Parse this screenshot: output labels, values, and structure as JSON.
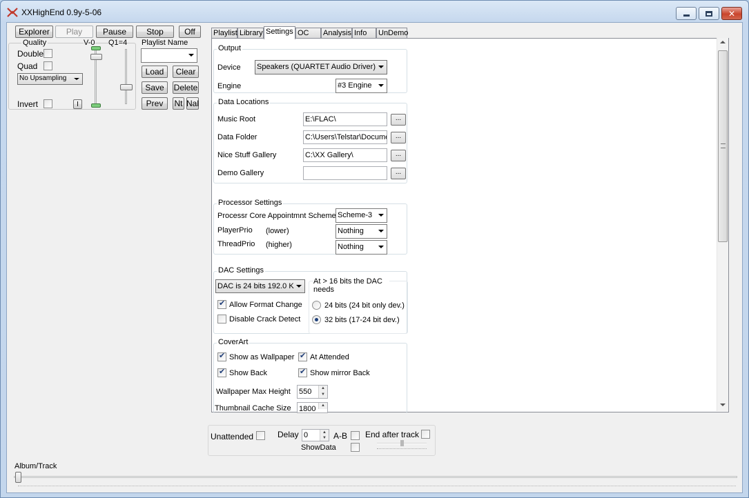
{
  "window": {
    "title": "XXHighEnd 0.9y-5-06"
  },
  "toolbar": {
    "explorer": "Explorer",
    "play": "Play",
    "pause": "Pause",
    "stop": "Stop",
    "off": "Off"
  },
  "quality": {
    "label": "Quality",
    "double": "Double",
    "quad": "Quad",
    "upsampling": "No Upsampling",
    "invert": "Invert",
    "i_button": "I",
    "v_label": "V-0",
    "q_label": "Q1=4"
  },
  "playlist_panel": {
    "name_label": "Playlist Name",
    "name_value": "",
    "load": "Load",
    "clear": "Clear",
    "save": "Save",
    "delete": "Delete",
    "prev": "Prev",
    "nt": "Nt",
    "nal": "Nal"
  },
  "tabs": [
    "Playlist",
    "Library",
    "Settings",
    "OC",
    "Analysis",
    "Info",
    "UnDemo"
  ],
  "active_tab": "Settings",
  "settings": {
    "output": {
      "title": "Output",
      "device_label": "Device",
      "device_value": "Speakers (QUARTET Audio Driver)",
      "engine_label": "Engine",
      "engine_value": "#3 Engine"
    },
    "data_locations": {
      "title": "Data Locations",
      "rows": [
        {
          "label": "Music Root",
          "value": "E:\\FLAC\\",
          "button": "..."
        },
        {
          "label": "Data Folder",
          "value": "C:\\Users\\Telstar\\Docume",
          "button": "..."
        },
        {
          "label": "Nice Stuff Gallery",
          "value": "C:\\XX Gallery\\",
          "button": "..."
        },
        {
          "label": "Demo Gallery",
          "value": "",
          "button": "..."
        }
      ]
    },
    "processor": {
      "title": "Processor Settings",
      "scheme_label": "Processr Core Appointmnt Scheme",
      "scheme_value": "Scheme-3",
      "player_label": "PlayerPrio",
      "player_hint": "(lower)",
      "player_value": "Nothing",
      "thread_label": "ThreadPrio",
      "thread_hint": "(higher)",
      "thread_value": "Nothing"
    },
    "dac": {
      "title": "DAC Settings",
      "dac_value": "DAC is 24 bits 192.0 K",
      "allow_format": "Allow Format Change",
      "allow_format_checked": true,
      "disable_crack": "Disable Crack Detect",
      "disable_crack_checked": false,
      "needs_label": "At > 16 bits the DAC needs",
      "opt24": "24 bits (24 bit only dev.)",
      "opt32": "32 bits (17-24 bit dev.)",
      "selected": "32"
    },
    "coverart": {
      "title": "CoverArt",
      "show_wallpaper": "Show as Wallpaper",
      "at_attended": "At Attended",
      "show_back": "Show Back",
      "show_mirror_back": "Show mirror Back",
      "wallpaper_max_height_label": "Wallpaper Max Height",
      "wallpaper_max_height": "550",
      "thumb_cache_label": "Thumbnail Cache Size",
      "thumb_cache": "1800"
    }
  },
  "bottom_bar": {
    "unattended": "Unattended",
    "delay_label": "Delay",
    "delay_value": "0",
    "ab": "A-B",
    "end_after_track": "End after track",
    "showdata": "ShowData"
  },
  "album_track": {
    "label": "Album/Track",
    "position": 0.0
  }
}
